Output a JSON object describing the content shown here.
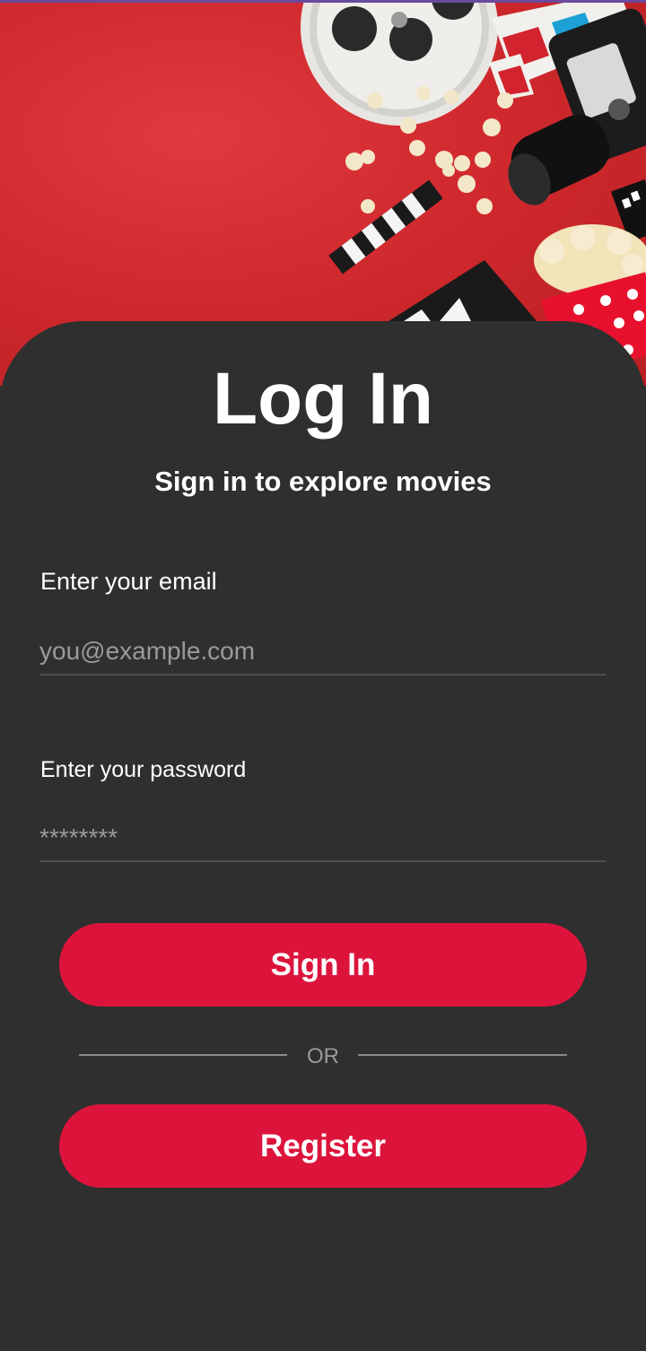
{
  "hero": {
    "image": "cinema-props-on-red-background",
    "background_color": "#d12a2e"
  },
  "header": {
    "title": "Log In",
    "subtitle": "Sign in to explore movies"
  },
  "form": {
    "email_label": "Enter your email",
    "email_placeholder": "you@example.com",
    "email_value": "",
    "password_label": "Enter your password",
    "password_placeholder": "********",
    "password_value": ""
  },
  "actions": {
    "sign_in_label": "Sign In",
    "divider_label": "OR",
    "register_label": "Register"
  },
  "colors": {
    "accent": "#dc143c",
    "background": "#2f2f2f",
    "text": "#ffffff",
    "placeholder": "#9a9a9a"
  }
}
